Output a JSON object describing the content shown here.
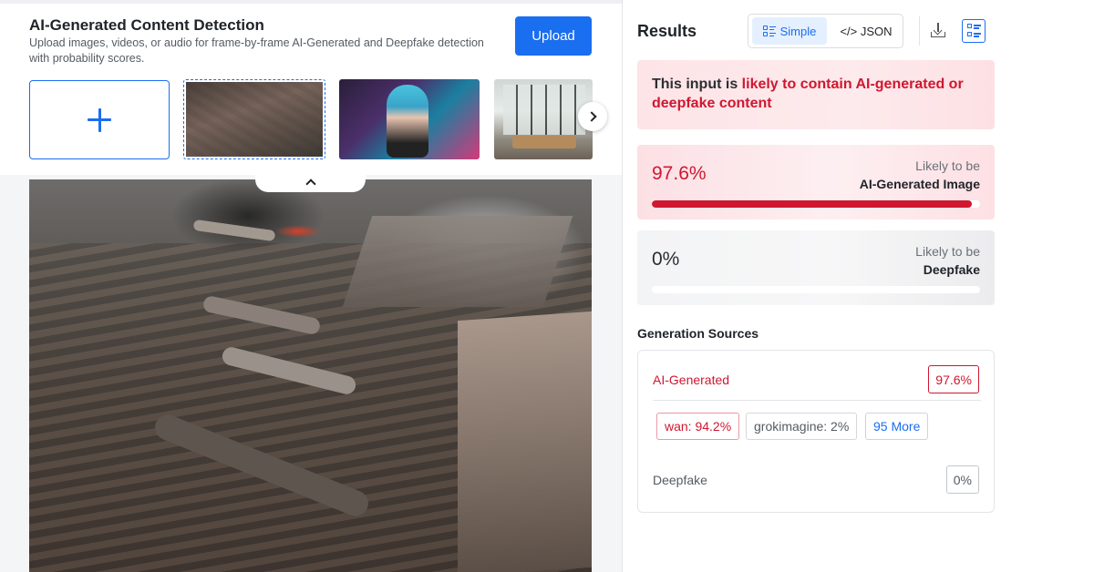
{
  "header": {
    "title": "AI-Generated Content Detection",
    "subtitle": "Upload images, videos, or audio for frame-by-frame AI-Generated and Deepfake detection with probability scores.",
    "upload_label": "Upload"
  },
  "gallery": {
    "add_icon": "plus-icon",
    "next_icon": "chevron-right-icon",
    "collapse_icon": "chevron-up-icon"
  },
  "results": {
    "title": "Results",
    "view_toggle": {
      "simple_label": "Simple",
      "json_label": "</> JSON",
      "selected": "Simple"
    },
    "verdict": {
      "prefix": "This input is ",
      "highlight": "likely to contain AI-generated or deepfake content"
    },
    "cards": [
      {
        "percent_text": "97.6%",
        "percent_value": 97.6,
        "line1": "Likely to be",
        "line2": "AI-Generated Image"
      },
      {
        "percent_text": "0%",
        "percent_value": 0,
        "line1": "Likely to be",
        "line2": "Deepfake"
      }
    ],
    "generation_sources": {
      "title": "Generation Sources",
      "ai_label": "AI-Generated",
      "ai_value": "97.6%",
      "sources": [
        "wan: 94.2%",
        "grokimagine: 2%"
      ],
      "more_label": "95 More",
      "deepfake_label": "Deepfake",
      "deepfake_value": "0%"
    }
  },
  "colors": {
    "accent": "#1a6ef0",
    "danger": "#cf1730"
  }
}
